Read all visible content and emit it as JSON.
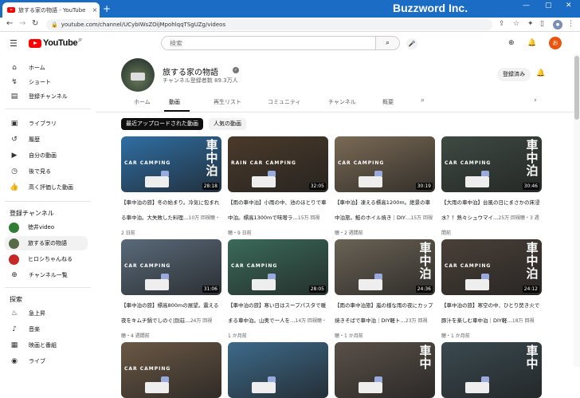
{
  "browser": {
    "tab_title": "旅する家の物語 - YouTube",
    "tab_close": "×",
    "new_tab": "+",
    "url": "youtube.com/channel/UCybIWsZOijMpohlqqTSgUZg/videos",
    "brand_overlay": "Buzzword Inc."
  },
  "header": {
    "logo_text": "YouTube",
    "logo_region": "JP",
    "search_placeholder": "検索",
    "avatar_letter": "お"
  },
  "sidebar": {
    "main": [
      {
        "label": "ホーム",
        "icon": "home-icon"
      },
      {
        "label": "ショート",
        "icon": "shorts-icon"
      },
      {
        "label": "登録チャンネル",
        "icon": "subscriptions-icon"
      }
    ],
    "library": [
      {
        "label": "ライブラリ",
        "icon": "library-icon"
      },
      {
        "label": "履歴",
        "icon": "history-icon"
      },
      {
        "label": "自分の動画",
        "icon": "my-videos-icon"
      },
      {
        "label": "後で見る",
        "icon": "watch-later-icon"
      },
      {
        "label": "高く評価した動画",
        "icon": "liked-icon"
      }
    ],
    "subs_heading": "登録チャンネル",
    "subs": [
      {
        "label": "徳井video",
        "color": "#2e7d32"
      },
      {
        "label": "旅する家の物語",
        "color": "#556b4a"
      },
      {
        "label": "ヒロシちゃんねる",
        "color": "#c62828"
      }
    ],
    "subs_more": "チャンネル一覧",
    "explore_heading": "探索",
    "explore": [
      {
        "label": "急上昇",
        "icon": "trending-icon"
      },
      {
        "label": "音楽",
        "icon": "music-icon"
      },
      {
        "label": "映画と番組",
        "icon": "movies-icon"
      },
      {
        "label": "ライブ",
        "icon": "live-icon"
      }
    ]
  },
  "channel": {
    "name": "旅する家の物語",
    "subscribers": "チャンネル登録者数 89.3万人",
    "subscribe_state": "登録済み",
    "tabs": [
      "ホーム",
      "動画",
      "再生リスト",
      "コミュニティ",
      "チャンネル",
      "概要"
    ],
    "active_tab": "動画",
    "chips": [
      "最近アップロードされた動画",
      "人気の動画"
    ]
  },
  "videos": [
    {
      "title": "【車中泊の旅】冬の始まり。冷気に包まれる車中泊。大失敗した料理…",
      "meta": "10万 回視聴・2 日前",
      "duration": "28:18",
      "overlay": "CAR CAMPING",
      "kanji": "車中泊",
      "bg": "#2f6ea3"
    },
    {
      "title": "【雨の車中泊】小雨の中、池のほとりで車中泊。標高1300mで味噌ラ…",
      "meta": "15万 回視聴・9 日前",
      "duration": "32:05",
      "overlay": "RAIN CAR CAMPING",
      "kanji": "",
      "bg": "#4a3a2a"
    },
    {
      "title": "【車中泊】凍える標高1200m。絶景の車中泊旅。鮭のホイル焼き｜DIY…",
      "meta": "15万 回視聴・2 週間前",
      "duration": "30:19",
      "overlay": "CAR CAMPING",
      "kanji": "",
      "bg": "#7a6a55"
    },
    {
      "title": "【大雨の車中泊】台風の日にまさかの床浸水？！熱々シュウマイ…",
      "meta": "25万 回視聴・3 週間前",
      "duration": "30:46",
      "overlay": "CAR CAMPING",
      "kanji": "車中泊",
      "bg": "#3e4a42"
    },
    {
      "title": "【車中泊の旅】標高800mの展望。震える夜をキムチ鍋でしのぐ|別荘…",
      "meta": "24万 回視聴・4 週間前",
      "duration": "31:06",
      "overlay": "CAR CAMPING",
      "kanji": "",
      "bg": "#5a6a7a"
    },
    {
      "title": "【車中泊の旅】寒い日はスープパスタで暖まる車中泊。山奥で一人を…",
      "meta": "14万 回視聴・1 か月前",
      "duration": "28:05",
      "overlay": "CAR CAMPING",
      "kanji": "",
      "bg": "#3a6a5a"
    },
    {
      "title": "【雨の車中泊旅】嵐の様な雨の夜にカップ焼きそばで車中泊｜DIY軽ト…",
      "meta": "23万 回視聴・1 か月前",
      "duration": "24:36",
      "overlay": "",
      "kanji": "車中泊",
      "bg": "#6a6255"
    },
    {
      "title": "【車中泊の旅】寒空の中、ひとり焚き火で豚汁を楽しむ車中泊｜DIY軽…",
      "meta": "18万 回視聴・1 か月前",
      "duration": "24:12",
      "overlay": "CAR CAMPING",
      "kanji": "車中泊",
      "bg": "#4a4038"
    },
    {
      "title": "",
      "meta": "",
      "duration": "",
      "overlay": "CAR CAMPING",
      "kanji": "",
      "bg": "#6b5845"
    },
    {
      "title": "",
      "meta": "",
      "duration": "",
      "overlay": "",
      "kanji": "",
      "bg": "#3d6a8a"
    },
    {
      "title": "",
      "meta": "",
      "duration": "",
      "overlay": "",
      "kanji": "車中",
      "bg": "#5a5048"
    },
    {
      "title": "",
      "meta": "",
      "duration": "",
      "overlay": "",
      "kanji": "車中",
      "bg": "#3a4a50"
    }
  ]
}
